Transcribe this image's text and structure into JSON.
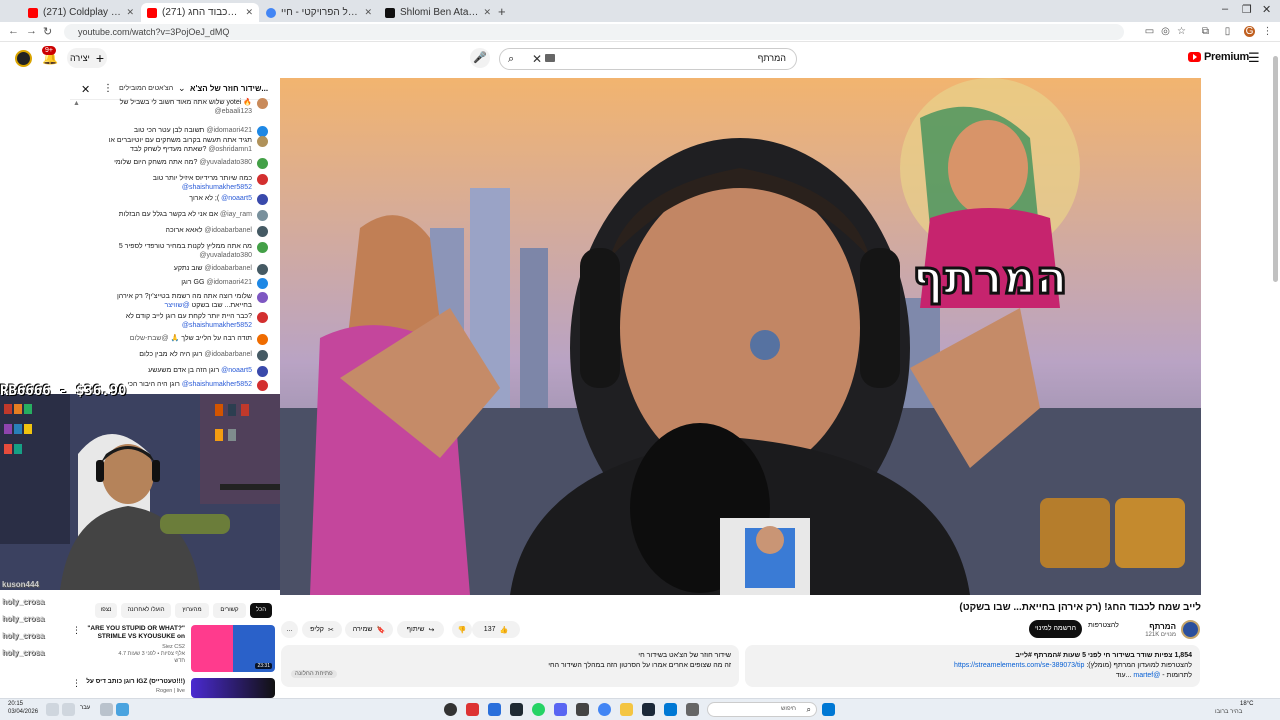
{
  "browser": {
    "tabs": [
      {
        "title": "(271) Coldplay - Viva La Vida (O...",
        "color": "#ff0000",
        "active": false
      },
      {
        "title": "(271) לייב שמח לכבוד החג! (...",
        "color": "#ff0000",
        "active": true
      },
      {
        "title": "שלמי בן עטר וכל הפרויקטי - חיי...",
        "color": "#4285f4",
        "active": false
      },
      {
        "title": "Shlomi Ben Atar (@המרתף) - TikT...",
        "color": "#111111",
        "active": false
      }
    ],
    "new_tab": "+",
    "url": "youtube.com/watch?v=3PojOeJ_dMQ",
    "window_controls": {
      "minimize": "–",
      "maximize": "❐",
      "close": "✕"
    }
  },
  "masthead": {
    "notification_count": "9+",
    "create_label": "יצירה",
    "search_query": "המרתף",
    "logo_text": "Premium",
    "menu_icon": "hamburger-icon"
  },
  "chat": {
    "title": "שידור חוזר של הצ'א...",
    "top_label": "הצ'אטים המובילים",
    "messages": [
      {
        "author": "@ebaali123",
        "text": "שלוש אתה מאוד חשוב לי בשביל של yotei 🔥",
        "avatar": "#c98a5a",
        "mod": false
      },
      {
        "author": "@idomaori421",
        "text": "תשובה לבן עטר הכי טוב",
        "avatar": "#1e88e5",
        "mod": false
      },
      {
        "author": "@oshridamn1",
        "text": "תגיד אתה תעשה בקרוב משחקים עם יוטיוברים או שאתה מעדיף לשחק לבד?",
        "avatar": "#b0925a",
        "mod": false
      },
      {
        "author": "@yuvaladato380",
        "text": "מה אתה משחק היום שלומי?",
        "avatar": "#43a047",
        "mod": false
      },
      {
        "author": "@shaishumakher5852",
        "text": "כמה שיותר מרידיוס איזיל יותר טוב",
        "avatar": "#d32f2f",
        "mod": true
      },
      {
        "author": "@noaart5",
        "text": "לא ארוך ;(",
        "avatar": "#3949ab",
        "mod": true
      },
      {
        "author": "@iay_ram",
        "text": "אם אני לא בקשר בגלל עם הבזלות",
        "avatar": "#78909c",
        "mod": false
      },
      {
        "author": "@idoabarbanel",
        "text": "לאאא ארוכה",
        "avatar": "#455a64",
        "mod": false
      },
      {
        "author": "@yuvaladato380",
        "text": "מה אתה ממליץ לקנות במחיר טורפדי לספיר 5",
        "avatar": "#43a047",
        "mod": false
      },
      {
        "author": "@idoabarbanel",
        "text": "שוב נתקע",
        "avatar": "#455a64",
        "mod": false
      },
      {
        "author": "@idomaori421",
        "text": "רוגן GG",
        "avatar": "#1e88e5",
        "mod": false
      },
      {
        "author": "@שוויצר",
        "text": "שלומי רוצה אתה מה רשמת בטייצ'ין? רק אירהן בחייאת... שבו בשקט",
        "avatar": "#7e57c2",
        "mod": true
      },
      {
        "author": "@shaishumakher5852",
        "text": "כבר היית יותר לקחת עם רוגן לייב קודם לא?",
        "avatar": "#d32f2f",
        "mod": true
      },
      {
        "author": "@שבת-שלום",
        "text": "תודה רבה על הלייב שלך 🙏",
        "avatar": "#ef6c00",
        "mod": false
      },
      {
        "author": "@idoabarbanel",
        "text": "רוגן היה לא מבין כלום",
        "avatar": "#455a64",
        "mod": false
      },
      {
        "author": "@noaart5",
        "text": "רוגן הזה בן אדם משעשע",
        "avatar": "#3949ab",
        "mod": true
      },
      {
        "author": "@shaishumakher5852",
        "text": "רוגן היה היבור הכי",
        "avatar": "#d32f2f",
        "mod": true
      }
    ]
  },
  "webcam": {
    "donation_text": "RB6666 - $36.90",
    "overlay_lines": [
      "kuson444",
      "holy_crosa",
      "holy_crosa",
      "holy_crosa",
      "holy_crosa"
    ]
  },
  "video": {
    "title": "לייב שמח לכבוד החג! (רק אירהן בחייאת... שבו בשקט)",
    "thumbnail_text": "המרתף",
    "channel_name": "המרתף",
    "channel_subs": "121K מנויים",
    "join_label": "להצטרפות",
    "subscribe_label": "הרשמה למינוי",
    "like_count": "137",
    "share_label": "שיתוף",
    "save_label": "שמירה",
    "clip_label": "קליפ",
    "more_label": "...",
    "description": {
      "stats": "1,854 צפיות  שודר בשידור חי לפני 5 שעות  #המרתף #לייב",
      "line2": "להצטרפות למועדון המרתף (מומלץ):",
      "link": "https://streamelements.com/se-389073/tip",
      "line3": "לתרומות - ",
      "handle": "@martef",
      "more": "...עוד"
    },
    "livechat": {
      "title": "שידור חוזר של הצ'אט בשידור חי",
      "subtitle": "זה מה שצופים אחרים אמרו על הסרטון הזה במהלך השידור החי",
      "button": "פתיחת החלונה"
    }
  },
  "chips": [
    "הכל",
    "קשורים",
    "מהערוץ",
    "הועלו לאחרונה",
    "נצפו"
  ],
  "recommendations": [
    {
      "title": "\"ARE YOU STUPID OR WHAT?\" STRIMLE VS KYOUSUKE on",
      "channel": "Siez CS2",
      "meta": "4.7 אלף צפיות • לפני 3 שעות",
      "extra": "חדש",
      "duration": "23:31",
      "thumb_a": "#ff3b8d",
      "thumb_b": "#2a61c9"
    },
    {
      "title": "רוגן כותב דיס על IGZ (טעטרייס!!!)",
      "channel": "Rogen | live",
      "meta": "",
      "extra": "",
      "duration": "",
      "thumb_a": "#4a2ad1",
      "thumb_b": "#111"
    }
  ],
  "taskbar": {
    "time": "20:15",
    "date": "03/04/2026",
    "lang": "עבר",
    "search_placeholder": "חיפוש",
    "weather_temp": "18°C",
    "weather_desc": "בהיר ברובו"
  }
}
